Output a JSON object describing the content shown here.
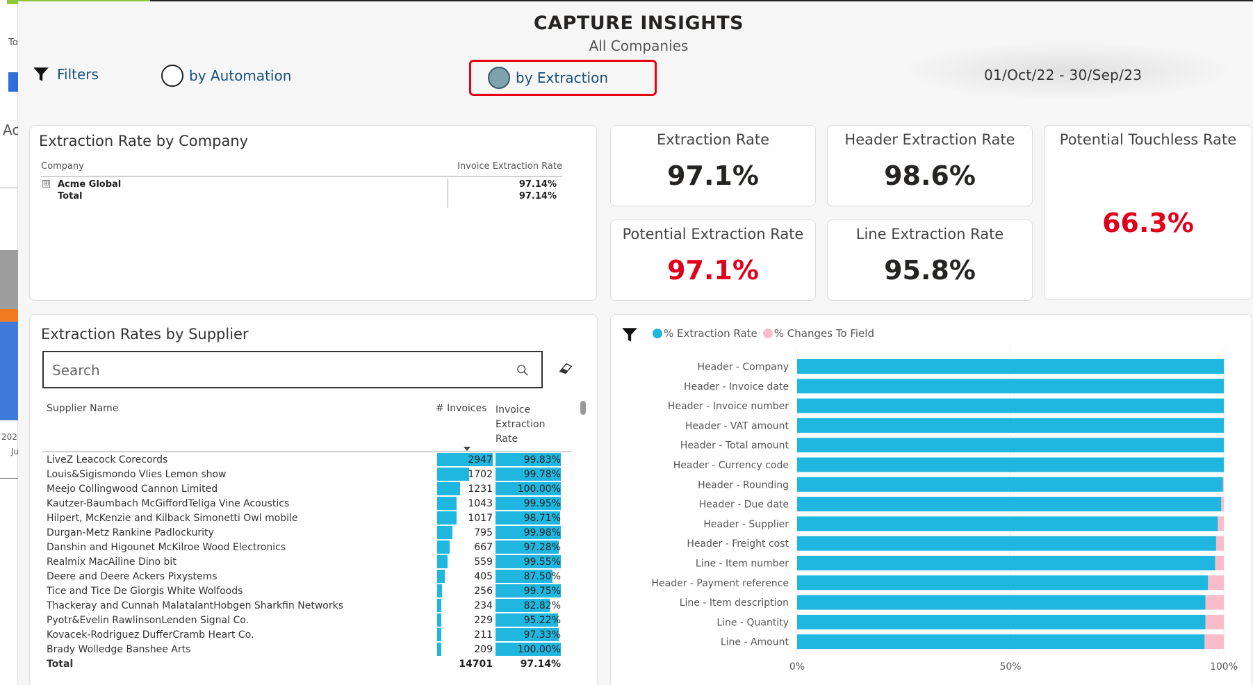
{
  "background": {
    "left_texts": [
      "To",
      "Ac",
      "202",
      "Ju"
    ]
  },
  "header": {
    "title": "CAPTURE INSIGHTS",
    "subtitle": "All Companies",
    "filters_label": "Filters",
    "by_automation_label": "by Automation",
    "by_extraction_label": "by Extraction",
    "selected_view": "by Extraction",
    "date_range": "01/Oct/22 - 30/Sep/23"
  },
  "company_panel": {
    "title": "Extraction Rate by Company",
    "col_company": "Company",
    "col_rate": "Invoice Extraction Rate",
    "rows": [
      {
        "name": "Acme Global",
        "rate": "97.14%",
        "expandable": true
      },
      {
        "name": "Total",
        "rate": "97.14%",
        "expandable": false
      }
    ],
    "expander_glyph": "⊞"
  },
  "kpis": {
    "extraction_rate": {
      "title": "Extraction Rate",
      "value": "97.1%"
    },
    "header_extraction_rate": {
      "title": "Header Extraction Rate",
      "value": "98.6%"
    },
    "potential_touchless_rate": {
      "title": "Potential Touchless Rate",
      "value": "66.3%"
    },
    "potential_extraction_rate": {
      "title": "Potential Extraction Rate",
      "value": "97.1%"
    },
    "line_extraction_rate": {
      "title": "Line Extraction Rate",
      "value": "95.8%"
    }
  },
  "colors": {
    "accent_blue": "#1fb7e0",
    "accent_pink": "#f8bccb",
    "alert_red": "#e0001b",
    "title_dark": "#252423",
    "link_blue": "#1a4f7a"
  },
  "supplier_panel": {
    "title": "Extraction Rates by Supplier",
    "search_placeholder": "Search",
    "col_supplier": "Supplier Name",
    "col_invoices": "# Invoices",
    "col_rate_line1": "Invoice",
    "col_rate_line2": "Extraction",
    "col_rate_line3": "Rate",
    "rows": [
      {
        "name": "LiveZ Leacock Corecords",
        "invoices": "2947",
        "rate": "99.83%",
        "inv_frac": 1.0,
        "rate_frac": 0.9983
      },
      {
        "name": "Louis&Sigismondo Vlies Lemon show",
        "invoices": "1702",
        "rate": "99.78%",
        "inv_frac": 0.5775,
        "rate_frac": 0.9978
      },
      {
        "name": "Meejo Collingwood Cannon Limited",
        "invoices": "1231",
        "rate": "100.00%",
        "inv_frac": 0.4177,
        "rate_frac": 1.0
      },
      {
        "name": "Kautzer-Baumbach McGiffordTeliga Vine Acoustics",
        "invoices": "1043",
        "rate": "99.95%",
        "inv_frac": 0.3539,
        "rate_frac": 0.9995
      },
      {
        "name": "Hilpert, McKenzie and Kilback Simonetti Owl mobile",
        "invoices": "1017",
        "rate": "98.71%",
        "inv_frac": 0.3451,
        "rate_frac": 0.9871
      },
      {
        "name": "Durgan-Metz Rankine Padlockurity",
        "invoices": "795",
        "rate": "99.98%",
        "inv_frac": 0.2698,
        "rate_frac": 0.9998
      },
      {
        "name": "Danshin and Higounet McKilroe Wood Electronics",
        "invoices": "667",
        "rate": "97.28%",
        "inv_frac": 0.2263,
        "rate_frac": 0.9728
      },
      {
        "name": "Realmix MacAiline Dino bit",
        "invoices": "559",
        "rate": "99.55%",
        "inv_frac": 0.1897,
        "rate_frac": 0.9955
      },
      {
        "name": "Deere and Deere Ackers Pixystems",
        "invoices": "405",
        "rate": "87.50%",
        "inv_frac": 0.1374,
        "rate_frac": 0.875
      },
      {
        "name": "Tice and Tice De Giorgis White Wolfoods",
        "invoices": "256",
        "rate": "99.75%",
        "inv_frac": 0.0869,
        "rate_frac": 0.9975
      },
      {
        "name": "Thackeray and Cunnah MalatalantHobgen Sharkfin Networks",
        "invoices": "234",
        "rate": "82.82%",
        "inv_frac": 0.0794,
        "rate_frac": 0.8282
      },
      {
        "name": "Pyotr&Evelin RawlinsonLenden Signal Co.",
        "invoices": "229",
        "rate": "95.22%",
        "inv_frac": 0.0777,
        "rate_frac": 0.9522
      },
      {
        "name": "Kovacek-Rodriguez DufferCramb Heart Co.",
        "invoices": "211",
        "rate": "97.33%",
        "inv_frac": 0.0716,
        "rate_frac": 0.9733
      },
      {
        "name": "Brady Wolledge Banshee Arts",
        "invoices": "209",
        "rate": "100.00%",
        "inv_frac": 0.0709,
        "rate_frac": 1.0
      }
    ],
    "total": {
      "label": "Total",
      "invoices": "14701",
      "rate": "97.14%"
    }
  },
  "chart_panel": {
    "legend_extraction": "% Extraction Rate",
    "legend_changes": "% Changes To Field"
  },
  "chart_data": {
    "type": "bar",
    "orientation": "horizontal",
    "stacked": true,
    "categories": [
      "Header - Company",
      "Header - Invoice date",
      "Header - Invoice number",
      "Header - VAT amount",
      "Header - Total amount",
      "Header - Currency code",
      "Header - Rounding",
      "Header - Due date",
      "Header - Supplier",
      "Header - Freight cost",
      "Line - Item number",
      "Header - Payment reference",
      "Line - Item description",
      "Line - Quantity",
      "Line - Amount"
    ],
    "series": [
      {
        "name": "% Extraction Rate",
        "color": "#1fb7e0",
        "values": [
          100,
          100,
          100,
          100,
          100,
          100,
          99.8,
          99.4,
          98.6,
          98.2,
          98.0,
          96.3,
          95.7,
          95.7,
          95.5
        ]
      },
      {
        "name": "% Changes To Field",
        "color": "#f8bccb",
        "values": [
          0,
          0,
          0,
          0,
          0,
          0,
          0.2,
          0.6,
          1.4,
          1.8,
          2.0,
          3.7,
          4.3,
          4.3,
          4.5
        ]
      }
    ],
    "x_ticks": [
      "0%",
      "50%",
      "100%"
    ],
    "xlim": [
      0,
      100
    ],
    "grid": true,
    "legend_position": "top-left"
  }
}
